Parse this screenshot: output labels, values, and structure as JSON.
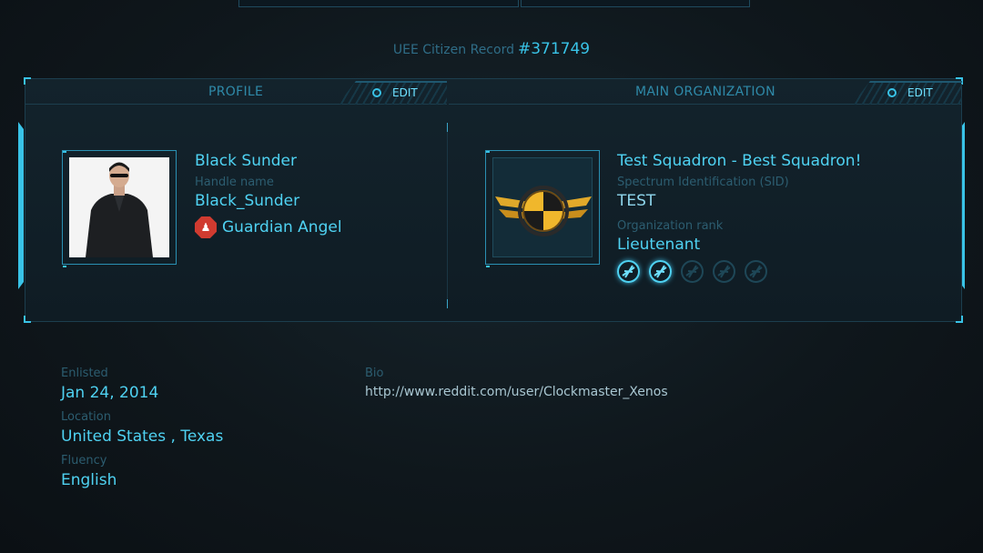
{
  "record": {
    "label": "UEE Citizen Record",
    "number": "#371749"
  },
  "profile": {
    "header": "PROFILE",
    "edit_label": "EDIT",
    "name": "Black Sunder",
    "handle_label": "Handle name",
    "handle": "Black_Sunder",
    "badge": {
      "icon": "guardian-angel-badge-icon",
      "label": "Guardian Angel",
      "color": "#d03b30"
    }
  },
  "organization": {
    "header": "MAIN ORGANIZATION",
    "edit_label": "EDIT",
    "name": "Test Squadron - Best Squadron!",
    "sid_label": "Spectrum Identification (SID)",
    "sid": "TEST",
    "rank_label": "Organization rank",
    "rank": "Lieutenant",
    "rank_level": 2,
    "rank_max": 5
  },
  "details": {
    "enlisted_label": "Enlisted",
    "enlisted": "Jan 24, 2014",
    "location_label": "Location",
    "location": "United States , Texas",
    "fluency_label": "Fluency",
    "fluency": "English",
    "bio_label": "Bio",
    "bio": "http://www.reddit.com/user/Clockmaster_Xenos"
  },
  "colors": {
    "accent": "#39c3e7",
    "text_bright": "#4fd2f2",
    "label_dim": "#2c5d70",
    "background": "#0f171c"
  }
}
